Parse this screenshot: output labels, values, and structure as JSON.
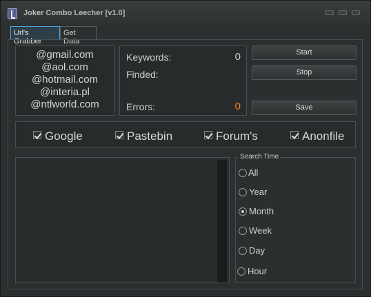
{
  "window": {
    "title": "Joker Combo Leecher [v1.0]"
  },
  "tabs": [
    {
      "label": "Url's Grabber",
      "active": true
    },
    {
      "label": "Get Data",
      "active": false
    }
  ],
  "emails": [
    "@gmail.com",
    "@aol.com",
    "@hotmail.com",
    "@interia.pl",
    "@ntlworld.com"
  ],
  "stats": {
    "keywords_label": "Keywords:",
    "keywords_value": "0",
    "finded_label": "Finded:",
    "errors_label": "Errors:",
    "errors_value": "0",
    "errors_color": "#e8822a"
  },
  "buttons": {
    "start": "Start",
    "stop": "Stop",
    "save": "Save"
  },
  "sources": [
    {
      "label": "Google",
      "checked": true
    },
    {
      "label": "Pastebin",
      "checked": true
    },
    {
      "label": "Forum's",
      "checked": true
    },
    {
      "label": "Anonfile",
      "checked": true
    }
  ],
  "search_time": {
    "title": "Search Time",
    "options": [
      {
        "label": "All",
        "selected": false
      },
      {
        "label": "Year",
        "selected": false
      },
      {
        "label": "Month",
        "selected": true
      },
      {
        "label": "Week",
        "selected": false
      },
      {
        "label": "Day",
        "selected": false
      },
      {
        "label": "Hour",
        "selected": false
      }
    ]
  },
  "accent_color": "#4aa3df"
}
